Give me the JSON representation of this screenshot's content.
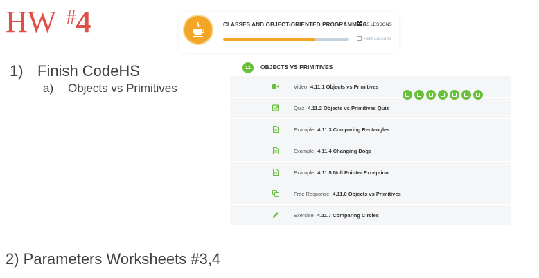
{
  "slide": {
    "title_hw": "HW",
    "title_hash": "#",
    "title_num": "4",
    "bullet1_num": "1)",
    "bullet1_text": "Finish CodeHS",
    "bullet2_num": "a)",
    "bullet2_text": "Objects vs Primitives",
    "bullet3_text": "2) Parameters Worksheets #3,4"
  },
  "course": {
    "title": "CLASSES AND OBJECT-ORIENTED PROGRAMMING",
    "lessons": "15 LESSONS",
    "hide_lessons": "Hide Lessons",
    "progress": 0.73,
    "colors": {
      "accent": "#f3a626",
      "track": "#c4d2dd"
    }
  },
  "lesson": {
    "number": "11",
    "title": "OBJECTS VS PRIMITIVES",
    "accent": "#6abf3b",
    "activities": [
      {
        "type": "Video",
        "name": "4.11.1 Objects vs Primitives",
        "icon": "video-icon"
      },
      {
        "type": "Quiz",
        "name": "4.11.2 Objects vs Primitives Quiz",
        "icon": "quiz-check-icon"
      },
      {
        "type": "Example",
        "name": "4.11.3 Comparing Rectangles",
        "icon": "document-icon"
      },
      {
        "type": "Example",
        "name": "4.11.4 Changing Dogs",
        "icon": "document-icon"
      },
      {
        "type": "Example",
        "name": "4.11.5 Null Pointer Exception",
        "icon": "document-icon"
      },
      {
        "type": "Free Response",
        "name": "4.11.6 Objects vs Primitives",
        "icon": "free-response-icon"
      },
      {
        "type": "Exercise",
        "name": "4.11.7 Comparing Circles",
        "icon": "pencil-icon"
      }
    ],
    "status_icons": [
      "video-icon",
      "quiz-check-icon",
      "document-icon",
      "document-icon",
      "document-icon",
      "free-response-icon",
      "pencil-icon"
    ]
  }
}
